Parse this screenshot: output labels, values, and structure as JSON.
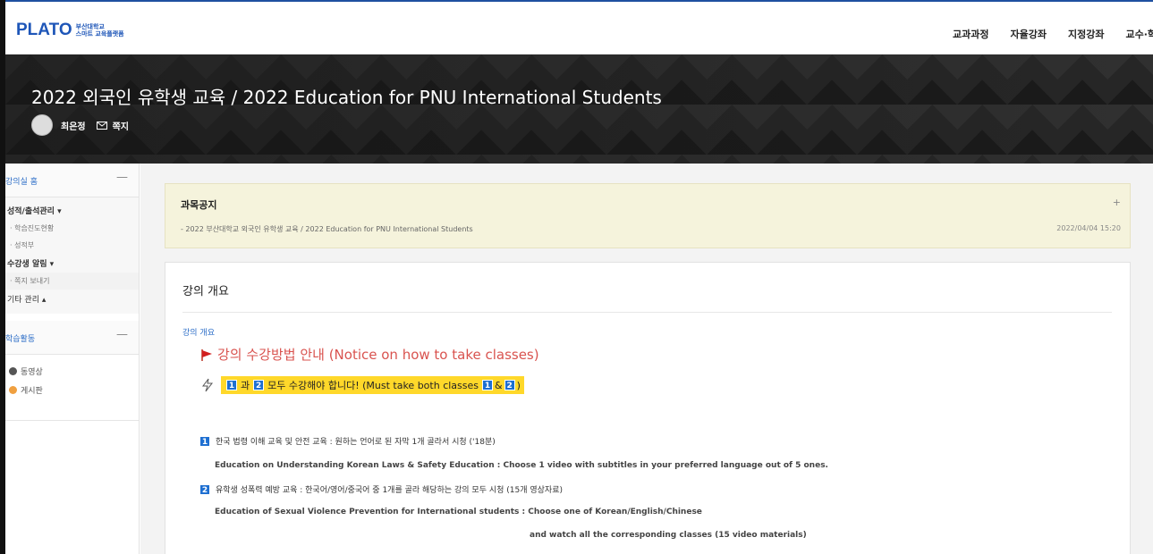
{
  "header": {
    "logo_main": "PLATO",
    "logo_sub_1": "부산대학교",
    "logo_sub_2": "스마트 교육플랫폼",
    "nav": [
      "교과과정",
      "자율강좌",
      "지정강좌",
      "교수·학"
    ]
  },
  "banner": {
    "course_title": "2022 외국인 유학생 교육 / 2022 Education for PNU International Students",
    "user_name": "최은정",
    "message_label": "쪽지",
    "avatar_icon": "user-avatar",
    "message_icon": "mail-icon"
  },
  "sidebar": {
    "home": {
      "label": "강의실 홈",
      "collapse": "—"
    },
    "groups": [
      {
        "label": "성적/출석관리 ▾",
        "items": [
          "· 학습진도현황",
          "· 성적부"
        ]
      },
      {
        "label": "수강생 알림 ▾",
        "items": [
          "· 쪽지 보내기"
        ]
      },
      {
        "label": "기타 관리 ▴",
        "items": []
      }
    ],
    "activities": {
      "label": "학습활동",
      "collapse": "—",
      "items": [
        {
          "label": "동영상",
          "icon": "video-icon",
          "color": "#555555"
        },
        {
          "label": "게시판",
          "icon": "board-icon",
          "color": "#f0a040"
        }
      ]
    }
  },
  "notice": {
    "title": "과목공지",
    "plus": "+",
    "item": "- 2022 부산대학교 외국인 유학생 교육 / 2022 Education for PNU International Students",
    "date": "2022/04/04 15:20"
  },
  "overview": {
    "title": "강의 개요",
    "section_label": "강의 개요",
    "flag_text": "강의 수강방법 안내 (Notice on how to take classes)",
    "highlight": {
      "n1": "1",
      "part1": "과",
      "n2": "2",
      "part2": "모두 수강해야 합니다! (Must take both classes",
      "n3": "1",
      "amp": "&",
      "n4": "2",
      "close": ")"
    },
    "item1_num": "1",
    "item1_ko": "한국 법령 이해 교육 및 안전 교육 : 원하는 언어로 된 자막 1개 골라서 시청 ('18분)",
    "item1_en": "Education on Understanding Korean Laws & Safety Education : Choose 1 video with subtitles in your preferred language out of 5 ones.",
    "item2_num": "2",
    "item2_ko": "유학생 성폭력 예방 교육 : 한국어/영어/중국어 중 1개를 골라 해당하는 강의 모두 시청 (15개 영상자료)",
    "item2_en": "Education of Sexual Violence Prevention for International students : Choose one of Korean/English/Chinese",
    "item2_en_2": "and watch all the corresponding classes (15 video materials)"
  },
  "colors": {
    "brand": "#1e56b8",
    "link": "#2a6cc7",
    "notice_bg": "#f5f3dc",
    "highlight": "#ffd82a",
    "flag": "#d9534f",
    "number_badge": "#1e6fd1"
  }
}
